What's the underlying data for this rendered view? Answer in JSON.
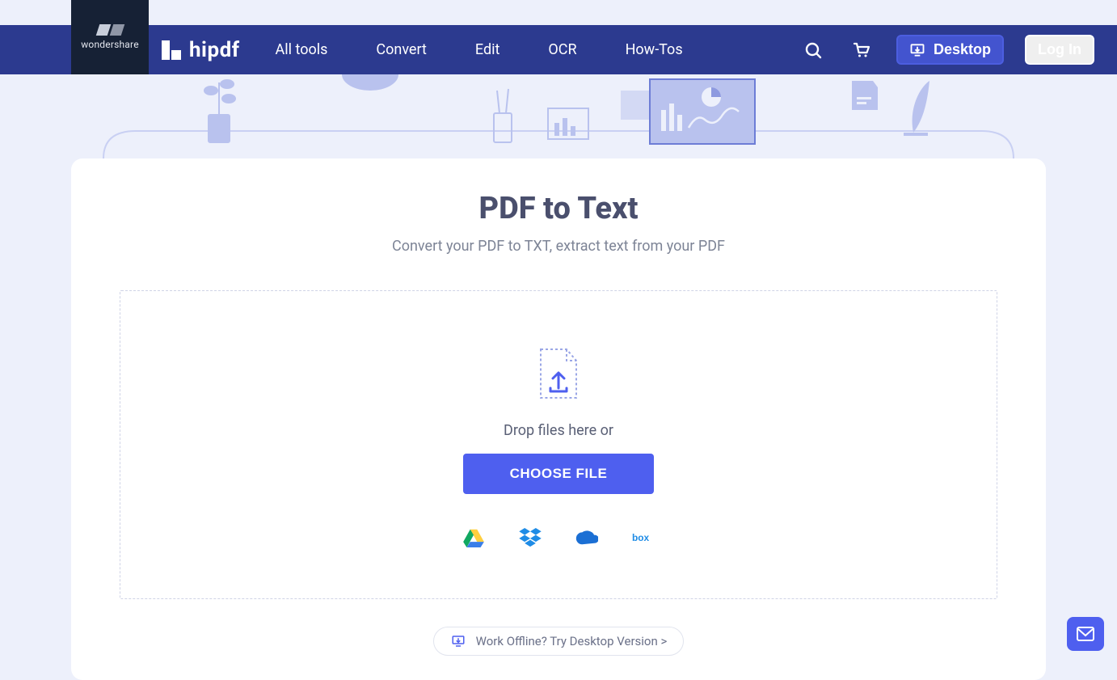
{
  "brand": {
    "wondershare_label": "wondershare",
    "product_name": "hipdf"
  },
  "nav": {
    "items": [
      "All tools",
      "Convert",
      "Edit",
      "OCR",
      "How-Tos"
    ],
    "desktop_label": "Desktop",
    "login_label": "Log In"
  },
  "page": {
    "title": "PDF to Text",
    "subtitle": "Convert your PDF to TXT, extract text from your PDF"
  },
  "dropzone": {
    "drop_text": "Drop files here or",
    "choose_label": "CHOOSE FILE",
    "cloud_sources": [
      "google-drive",
      "dropbox",
      "onedrive",
      "box"
    ]
  },
  "offline": {
    "label": "Work Offline? Try Desktop Version >"
  }
}
